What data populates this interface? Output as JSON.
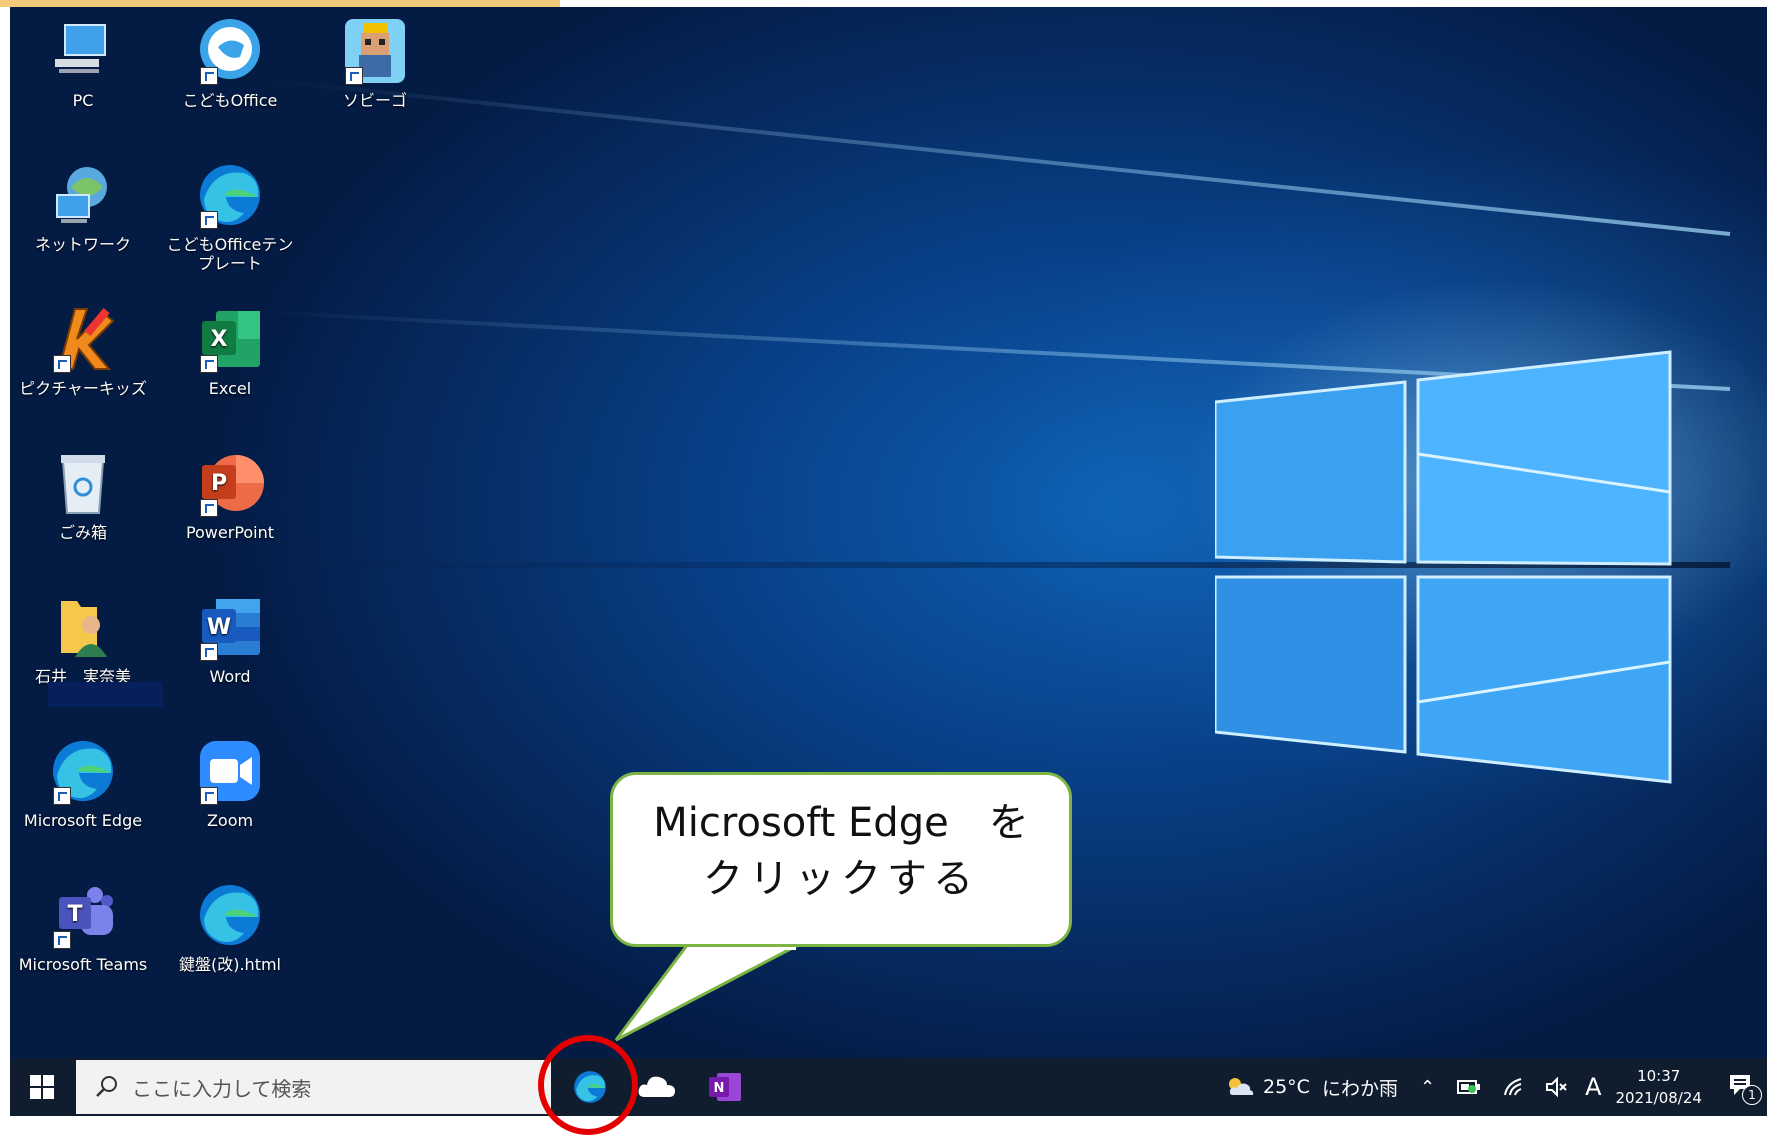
{
  "desktop": {
    "icons": [
      {
        "label": "PC"
      },
      {
        "label": "こどもOffice"
      },
      {
        "label": "ソビーゴ"
      },
      {
        "label": "ネットワーク"
      },
      {
        "label": "こどもOfficeテンプレート"
      },
      {
        "label": "ピクチャーキッズ"
      },
      {
        "label": "Excel"
      },
      {
        "label": "ごみ箱"
      },
      {
        "label": "PowerPoint"
      },
      {
        "label": "石井　実奈美"
      },
      {
        "label": "Word"
      },
      {
        "label": "Microsoft Edge"
      },
      {
        "label": "Zoom"
      },
      {
        "label": "Microsoft Teams"
      },
      {
        "label": "鍵盤(改).html"
      }
    ]
  },
  "callout": {
    "line1": "Microsoft Edge　を",
    "line2": "クリックする"
  },
  "taskbar": {
    "search_placeholder": "ここに入力して検索",
    "weather_temp": "25°C",
    "weather_text": "にわか雨",
    "ime": "A",
    "time": "10:37",
    "date": "2021/08/24",
    "notification_count": "1"
  },
  "colors": {
    "highlight": "#e40000",
    "callout_border": "#7db545",
    "taskbar": "#101d2e"
  }
}
